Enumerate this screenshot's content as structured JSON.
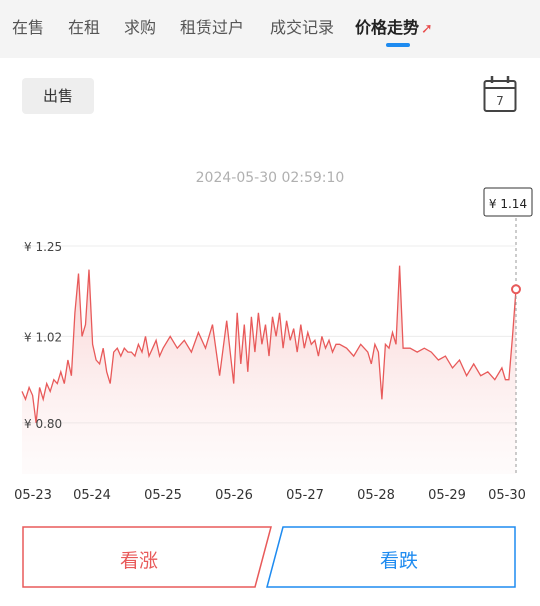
{
  "tabs": [
    {
      "label": "在售"
    },
    {
      "label": "在租"
    },
    {
      "label": "求购"
    },
    {
      "label": "租赁过户"
    },
    {
      "label": "成交记录"
    },
    {
      "label": "价格走势",
      "active": true
    }
  ],
  "type_button": "出售",
  "calendar_day": "7",
  "timestamp": "2024-05-30 02:59:10",
  "tooltip_value": "¥ 1.14",
  "rise_button": "看涨",
  "fall_button": "看跌",
  "colors": {
    "line": "#e85a5a",
    "rise": "#e85a5a",
    "fall": "#1e8bf0",
    "active_tab_underline": "#1e8bf0"
  },
  "chart_data": {
    "type": "area",
    "x_tick_labels": [
      "05-23",
      "05-24",
      "05-25",
      "05-26",
      "05-27",
      "05-28",
      "05-29",
      "05-30"
    ],
    "y_tick_labels": [
      "¥ 1.25",
      "¥ 1.02",
      "¥ 0.80"
    ],
    "y_ticks": [
      1.25,
      1.02,
      0.8
    ],
    "ylim": [
      0.67,
      1.25
    ],
    "xlim": [
      0,
      7
    ],
    "grid": true,
    "highlight_point": {
      "x": 7.0,
      "y": 1.14
    },
    "series": [
      {
        "x": [
          0.0,
          0.05,
          0.1,
          0.15,
          0.2,
          0.25,
          0.3,
          0.35,
          0.4,
          0.45,
          0.5,
          0.55,
          0.6,
          0.65,
          0.7,
          0.75,
          0.8,
          0.85,
          0.9,
          0.95,
          1.0,
          1.05,
          1.1,
          1.15,
          1.2,
          1.25,
          1.3,
          1.35,
          1.4,
          1.45,
          1.5,
          1.55,
          1.6,
          1.65,
          1.7,
          1.75,
          1.8,
          1.85,
          1.9,
          1.95,
          2.0,
          2.1,
          2.2,
          2.3,
          2.4,
          2.5,
          2.6,
          2.7,
          2.8,
          2.9,
          3.0,
          3.05,
          3.1,
          3.15,
          3.2,
          3.25,
          3.3,
          3.35,
          3.4,
          3.45,
          3.5,
          3.55,
          3.6,
          3.65,
          3.7,
          3.75,
          3.8,
          3.85,
          3.9,
          3.95,
          4.0,
          4.05,
          4.1,
          4.15,
          4.2,
          4.25,
          4.3,
          4.35,
          4.4,
          4.45,
          4.5,
          4.6,
          4.7,
          4.8,
          4.9,
          4.95,
          5.0,
          5.05,
          5.1,
          5.15,
          5.2,
          5.25,
          5.3,
          5.35,
          5.4,
          5.5,
          5.6,
          5.7,
          5.8,
          5.9,
          6.0,
          6.1,
          6.2,
          6.3,
          6.4,
          6.5,
          6.6,
          6.7,
          6.8,
          6.85,
          6.9,
          6.95,
          7.0
        ],
        "values": [
          0.88,
          0.86,
          0.89,
          0.87,
          0.8,
          0.89,
          0.86,
          0.9,
          0.88,
          0.91,
          0.9,
          0.93,
          0.9,
          0.96,
          0.92,
          1.08,
          1.18,
          1.02,
          1.05,
          1.19,
          1.0,
          0.96,
          0.95,
          0.99,
          0.93,
          0.9,
          0.98,
          0.99,
          0.97,
          0.99,
          0.98,
          0.98,
          0.97,
          1.0,
          0.98,
          1.02,
          0.97,
          0.99,
          1.01,
          0.97,
          0.99,
          1.02,
          0.99,
          1.01,
          0.98,
          1.03,
          0.99,
          1.05,
          0.92,
          1.06,
          0.9,
          1.08,
          0.95,
          1.05,
          0.93,
          1.07,
          0.98,
          1.08,
          1.0,
          1.05,
          0.97,
          1.07,
          1.02,
          1.08,
          0.99,
          1.06,
          1.01,
          1.04,
          0.98,
          1.05,
          0.99,
          1.03,
          1.0,
          1.01,
          0.97,
          1.02,
          0.99,
          1.01,
          0.98,
          1.0,
          1.0,
          0.99,
          0.97,
          1.0,
          0.98,
          0.95,
          1.0,
          0.98,
          0.86,
          1.0,
          0.99,
          1.03,
          1.0,
          1.2,
          0.99,
          0.99,
          0.98,
          0.99,
          0.98,
          0.96,
          0.97,
          0.94,
          0.96,
          0.92,
          0.95,
          0.92,
          0.93,
          0.91,
          0.94,
          0.91,
          0.91,
          1.02,
          1.14
        ]
      }
    ]
  }
}
